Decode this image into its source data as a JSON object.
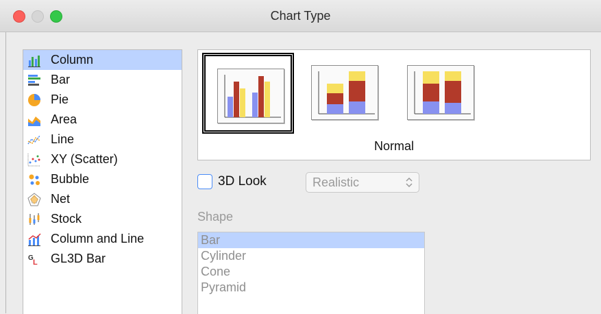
{
  "window": {
    "title": "Chart Type"
  },
  "chart_types": [
    {
      "label": "Column",
      "icon": "column-chart-icon",
      "selected": true
    },
    {
      "label": "Bar",
      "icon": "bar-chart-icon",
      "selected": false
    },
    {
      "label": "Pie",
      "icon": "pie-chart-icon",
      "selected": false
    },
    {
      "label": "Area",
      "icon": "area-chart-icon",
      "selected": false
    },
    {
      "label": "Line",
      "icon": "line-chart-icon",
      "selected": false
    },
    {
      "label": "XY (Scatter)",
      "icon": "scatter-chart-icon",
      "selected": false
    },
    {
      "label": "Bubble",
      "icon": "bubble-chart-icon",
      "selected": false
    },
    {
      "label": "Net",
      "icon": "net-chart-icon",
      "selected": false
    },
    {
      "label": "Stock",
      "icon": "stock-chart-icon",
      "selected": false
    },
    {
      "label": "Column and Line",
      "icon": "column-and-line-chart-icon",
      "selected": false
    },
    {
      "label": "GL3D Bar",
      "icon": "gl3d-bar-chart-icon",
      "selected": false
    }
  ],
  "variants": {
    "caption": "Normal",
    "items": [
      {
        "icon": "normal-column-variant-icon",
        "selected": true
      },
      {
        "icon": "stacked-column-variant-icon",
        "selected": false
      },
      {
        "icon": "percent-stacked-column-variant-icon",
        "selected": false
      }
    ]
  },
  "look3d": {
    "label": "3D Look",
    "checked": false,
    "scheme_value": "Realistic"
  },
  "shape": {
    "label": "Shape",
    "options": [
      {
        "label": "Bar",
        "selected": true
      },
      {
        "label": "Cylinder",
        "selected": false
      },
      {
        "label": "Cone",
        "selected": false
      },
      {
        "label": "Pyramid",
        "selected": false
      }
    ]
  },
  "colors": {
    "selection": "#bcd3ff",
    "accent": "#4a8cf7"
  }
}
